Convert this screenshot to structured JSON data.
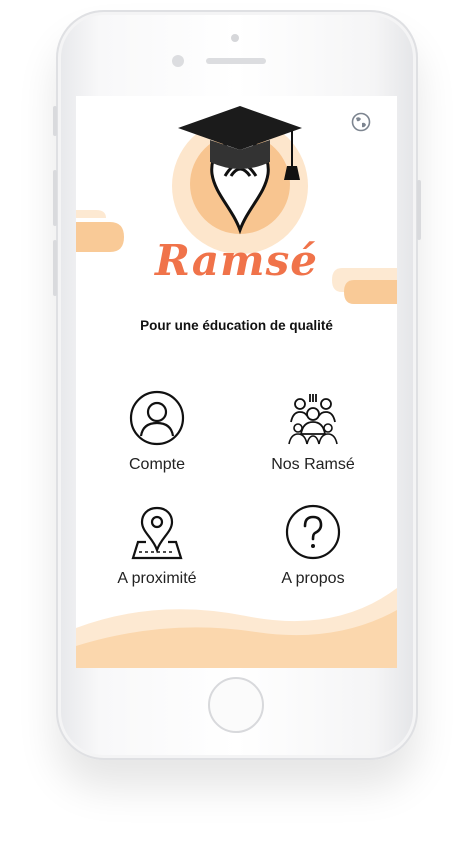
{
  "app": {
    "name": "Ramsé",
    "tagline": "Pour une éducation de qualité",
    "brand_color": "#f0734a",
    "accent_light": "#fde3c8",
    "accent_peach": "#f9c89a"
  },
  "header": {
    "language_icon": "globe-icon"
  },
  "menu": {
    "items": [
      {
        "label": "Compte",
        "icon": "user-icon"
      },
      {
        "label": "Nos Ramsé",
        "icon": "group-icon"
      },
      {
        "label": "A proximité",
        "icon": "map-pin-icon"
      },
      {
        "label": "A propos",
        "icon": "question-icon"
      }
    ]
  }
}
